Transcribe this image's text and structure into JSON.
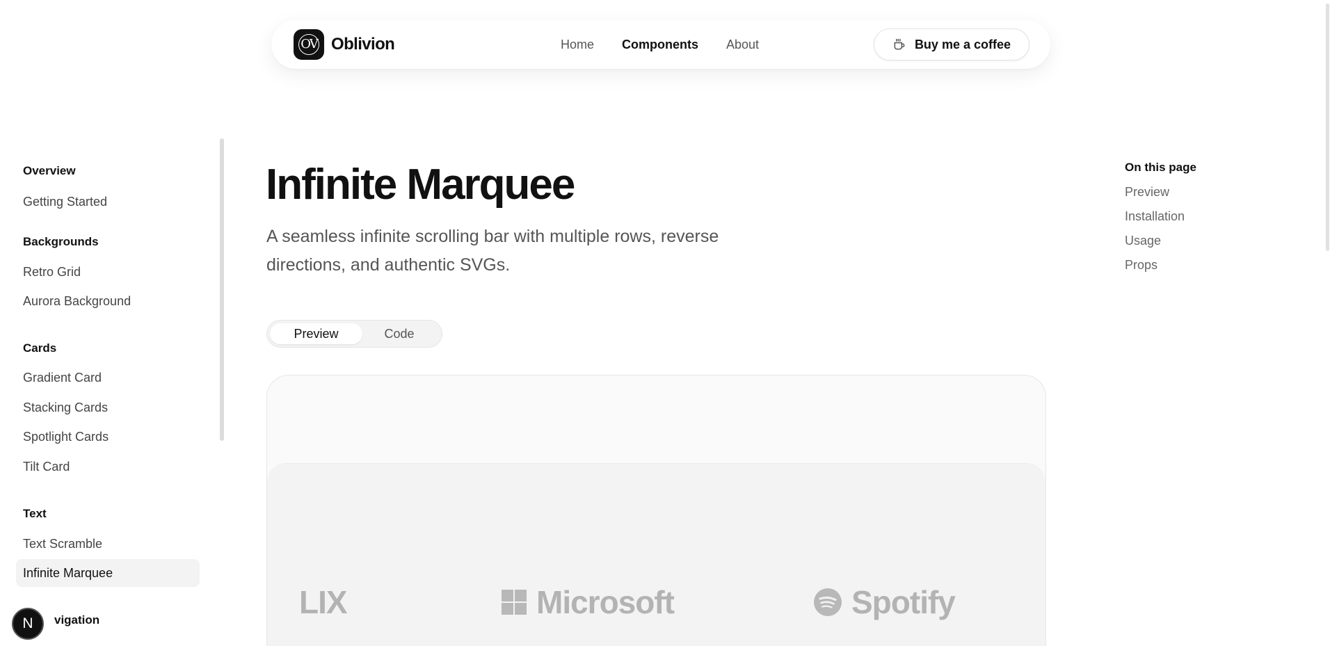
{
  "header": {
    "logo_text": "OV",
    "brand": "Oblivion",
    "nav": [
      {
        "label": "Home",
        "active": false
      },
      {
        "label": "Components",
        "active": true
      },
      {
        "label": "About",
        "active": false
      }
    ],
    "cta_label": "Buy me a coffee"
  },
  "sidebar": {
    "groups": [
      {
        "title": "Overview",
        "items": [
          "Getting Started"
        ]
      },
      {
        "title": "Backgrounds",
        "items": [
          "Retro Grid",
          "Aurora Background"
        ]
      },
      {
        "title": "Cards",
        "items": [
          "Gradient Card",
          "Stacking Cards",
          "Spotlight Cards",
          "Tilt Card"
        ]
      },
      {
        "title": "Text",
        "items": [
          "Text Scramble",
          "Infinite Marquee"
        ]
      },
      {
        "title": "vigation",
        "items": []
      }
    ],
    "active_item": "Infinite Marquee"
  },
  "main": {
    "title": "Infinite Marquee",
    "description": "A seamless infinite scrolling bar with multiple rows, reverse directions, and authentic SVGs.",
    "tabs": [
      {
        "label": "Preview",
        "active": true
      },
      {
        "label": "Code",
        "active": false
      }
    ],
    "marquee": [
      "LIX",
      "Microsoft",
      "Spotify"
    ]
  },
  "toc": {
    "title": "On this page",
    "items": [
      "Preview",
      "Installation",
      "Usage",
      "Props"
    ]
  },
  "badge": {
    "label": "N"
  },
  "colors": {
    "text": "#111111",
    "muted": "#555555",
    "logo_gray": "#b3b3b3"
  }
}
